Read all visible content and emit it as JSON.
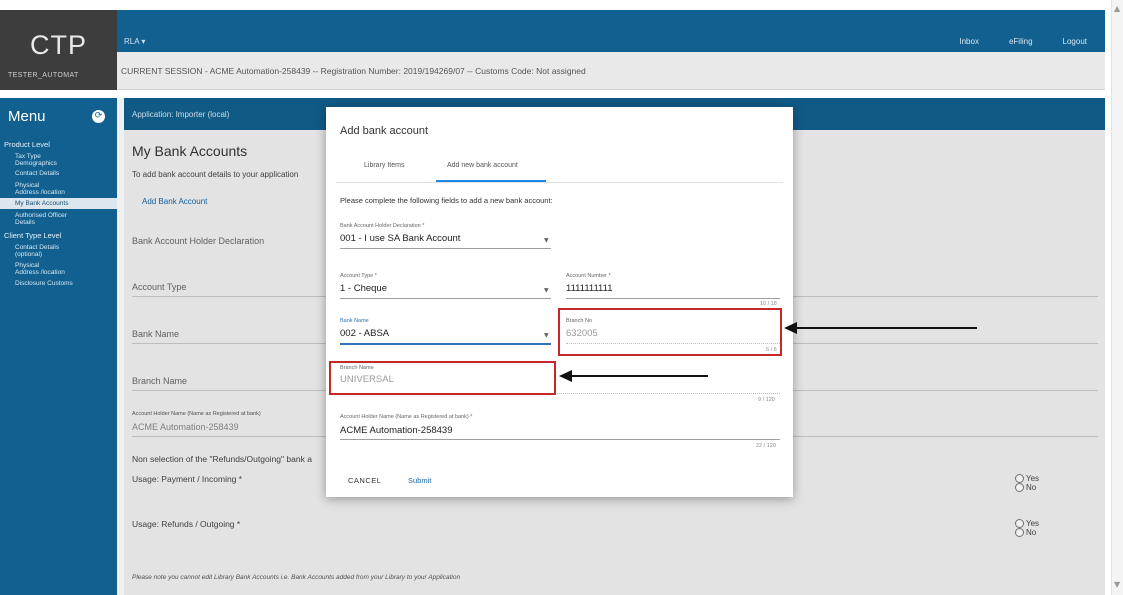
{
  "logo": {
    "text": "CTP",
    "user": "TESTER_AUTOMAT"
  },
  "topbar": {
    "rla": "RLA ▾",
    "links": [
      "Inbox",
      "eFiling",
      "Logout"
    ]
  },
  "session": {
    "text": "CURRENT SESSION - ACME Automation-258439 -- Registration Number: 2019/194269/07 -- Customs Code: Not assigned"
  },
  "sidebar": {
    "title": "Menu",
    "icon": "refresh-icon",
    "product_level": "Product Level",
    "product_items": [
      "Tax Type\nDemographics",
      "Contact Details",
      "Physical\nAddress /location",
      "My Bank Accounts",
      "Authorised Officer\nDetails"
    ],
    "client_level": "Client Type Level",
    "client_items": [
      "Contact Details\n(optional)",
      "Physical\nAddress /location",
      "Disclosure Customs"
    ]
  },
  "app_header": "Application: Importer (local)",
  "page": {
    "title": "My Bank Accounts",
    "intro": "To add bank account details to your application",
    "add_link": "Add Bank Account",
    "fields": {
      "holder_declaration": "Bank Account Holder Declaration",
      "account_type": "Account Type",
      "bank_name": "Bank Name",
      "branch_name": "Branch Name",
      "holder_name_label": "Account Holder Name (Name as Registered at bank)",
      "holder_name_value": "ACME Automation-258439"
    },
    "non_selection": "Non selection of the \"Refunds/Outgoing\" bank a",
    "usage_payment": "Usage: Payment / Incoming *",
    "usage_refunds": "Usage: Refunds / Outgoing *",
    "yes": "Yes",
    "no": "No",
    "note": "Please note  you cannot edit Library Bank Accounts i.e. Bank Accounts added from your Library to your Application"
  },
  "modal": {
    "title": "Add bank account",
    "tabs": [
      "Library Items",
      "Add new bank account"
    ],
    "intro": "Please complete the following fields to add a new bank account:",
    "holder_decl_label": "Bank Account Holder Declaration *",
    "holder_decl_value": "001 - I use SA Bank Account",
    "account_type_label": "Account Type *",
    "account_type_value": "1 - Cheque",
    "account_number_label": "Account Number *",
    "account_number_value": "1111111111",
    "account_number_counter": "10 / 18",
    "bank_name_label": "Bank Name",
    "bank_name_value": "002 - ABSA",
    "branch_no_label": "Branch No",
    "branch_no_value": "632005",
    "branch_no_counter": "6 / 6",
    "branch_name_label": "Branch Name",
    "branch_name_value": "UNIVERSAL",
    "branch_name_counter": "9 / 120",
    "holder_name_label": "Account Holder Name (Name as Registered at bank) *",
    "holder_name_value": "ACME Automation-258439",
    "holder_name_counter": "22 / 120",
    "cancel": "CANCEL",
    "submit": "Submit"
  },
  "colors": {
    "primary": "#12608f",
    "logo_bg": "#3d3d3d",
    "link": "#1565a8",
    "annotation": "#c62828"
  }
}
